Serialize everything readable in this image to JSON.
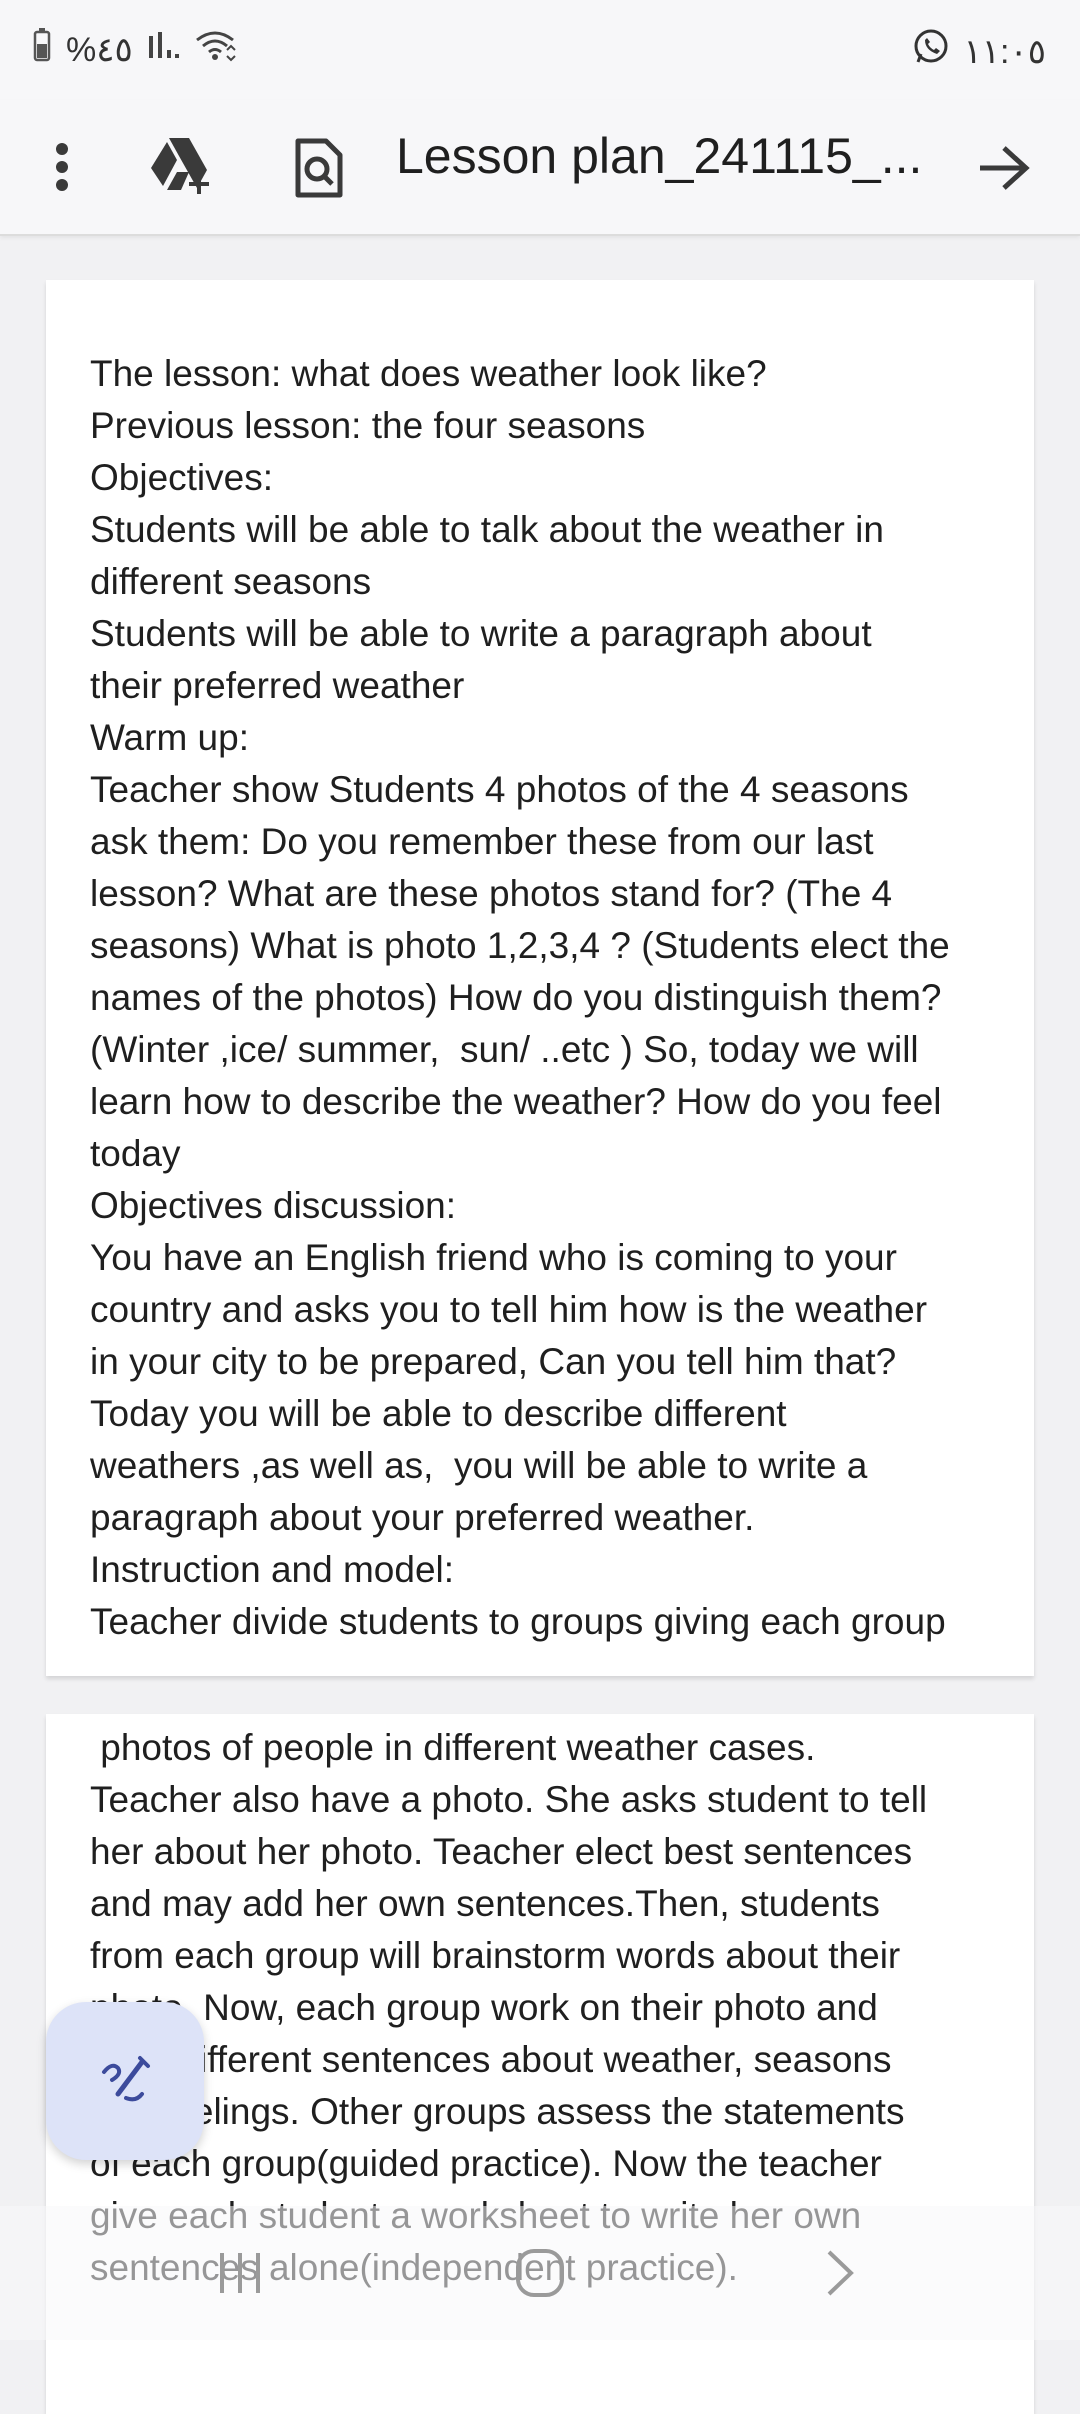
{
  "status_bar": {
    "battery_text": "%٤٥",
    "time": "١١:٠٥"
  },
  "app_bar": {
    "title": "Lesson plan_241115_..."
  },
  "document": {
    "page1_lines": [
      "The lesson: what does weather look like?",
      "Previous lesson: the four seasons",
      "Objectives:",
      "Students will be able to talk about the weather in",
      "different seasons",
      "Students will be able to write a paragraph about",
      "their preferred weather",
      "Warm up:",
      "Teacher show Students 4 photos of the 4 seasons",
      "ask them: Do you remember these from our last",
      "lesson? What are these photos stand for? (The 4",
      "seasons) What is photo 1,2,3,4 ? (Students elect the",
      "names of the photos) How do you distinguish them?",
      "(Winter ,ice/ summer,  sun/ ..etc ) So, today we will",
      "learn how to describe the weather? How do you feel",
      "today",
      "Objectives discussion:",
      "You have an English friend who is coming to your",
      "country and asks you to tell him how is the weather",
      "in your city to be prepared, Can you tell him that?",
      "Today you will be able to describe different",
      "weathers ,as well as,  you will be able to write a",
      "paragraph about your preferred weather.",
      "Instruction and model:",
      "Teacher divide students to groups giving each group"
    ],
    "page2_lines": [
      " photos of people in different weather cases.",
      "Teacher also have a photo. She asks student to tell",
      "her about her photo. Teacher elect best sentences",
      "and may add her own sentences.Then, students",
      "from each group will brainstorm words about their",
      "photo. Now, each group work on their photo and",
      "write different sentences about weather, seasons",
      "and feelings. Other groups assess the statements",
      "of each group(guided practice). Now the teacher",
      "give each student a worksheet to write her own",
      "sentences alone(independent practice)."
    ]
  },
  "colors": {
    "accent": "#3c4b9c",
    "fab_bg": "#dde3f8"
  },
  "icons": [
    "battery-icon",
    "signal-icon",
    "wifi-icon",
    "whatsapp-icon",
    "more-vert-icon",
    "drive-add-icon",
    "find-in-page-icon",
    "arrow-forward-icon",
    "edit-pen-icon",
    "recents-icon",
    "home-icon",
    "back-icon"
  ]
}
